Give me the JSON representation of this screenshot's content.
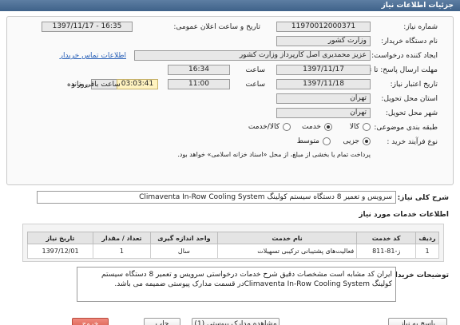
{
  "header": {
    "title": "جزئیات اطلاعات نیاز"
  },
  "form": {
    "need_number_label": "شماره نیاز:",
    "need_number": "11970012000371",
    "announce_label": "تاریخ و ساعت اعلان عمومی:",
    "announce_value": "1397/11/17 - 16:35",
    "buyer_org_label": "نام دستگاه خریدار:",
    "buyer_org": "وزارت کشور",
    "creator_label": "ایجاد کننده درخواست:",
    "creator": "عزیز محمدیری اصل کارپرداز وزارت کشور",
    "contact_link": "اطلاعات تماس خریدار",
    "send_deadline_label": "مهلت ارسال پاسخ: تا تاریخ:",
    "send_date": "1397/11/17",
    "time_label": "ساعت",
    "send_time": "16:34",
    "validity_label": "تاریخ اعتبار نیاز:",
    "validity_date": "1397/11/18",
    "validity_time": "11:00",
    "days_value": "0",
    "days_label": "روز و",
    "remaining_time": "03:03:41",
    "remaining_label": "ساعت باقی مانده",
    "province_label": "استان محل تحویل:",
    "province": "تهران",
    "city_label": "شهر محل تحویل:",
    "city": "تهران",
    "category_label": "طبقه بندی موضوعی:",
    "category_options": [
      "کالا",
      "خدمت",
      "کالا/خدمت"
    ],
    "purchase_label": "نوع فرآیند خرید :",
    "purchase_options": [
      "جزیی",
      "متوسط"
    ],
    "purchase_note": "پرداخت تمام یا بخشی از مبلغ، از محل «اسناد خزانه اسلامی» خواهد بود."
  },
  "summary": {
    "label": "شرح کلی نیاز:",
    "value": "سرویس و تعمیر 8 دستگاه سیستم کولینگ Climaventa In-Row Cooling System"
  },
  "services": {
    "section_title": "اطلاعات خدمات مورد نیاز",
    "columns": [
      "ردیف",
      "کد خدمت",
      "نام خدمت",
      "واحد اندازه گیری",
      "تعداد / مقدار",
      "تاریخ نیاز"
    ],
    "rows": [
      [
        "1",
        "ز-81-811",
        "فعالیت‌های پشتیبانی ترکیبی تسهیلات",
        "سال",
        "1",
        "1397/12/01"
      ]
    ]
  },
  "buyer_notes": {
    "label": "توضیحات خریدار:",
    "text_line1": "ایران کد مشابه است مشخصات دقیق شرح خدمات درخواستی سرویس و تعمیر 8 دستگاه سیستم",
    "text_line2": "کولینگ Climaventa In-Row Cooling Systemدر قسمت مدارک پیوستی ضمیمه می باشد."
  },
  "buttons": {
    "respond": "پاسخ به نیاز",
    "view_attachments": "مشاهده مدارک پیوستی (1)",
    "print": "چاپ",
    "exit": "خروج"
  },
  "colors": {
    "header_bg": "#4a6d95",
    "link": "#2a61b8",
    "remaining_bg": "#fff3c0"
  }
}
